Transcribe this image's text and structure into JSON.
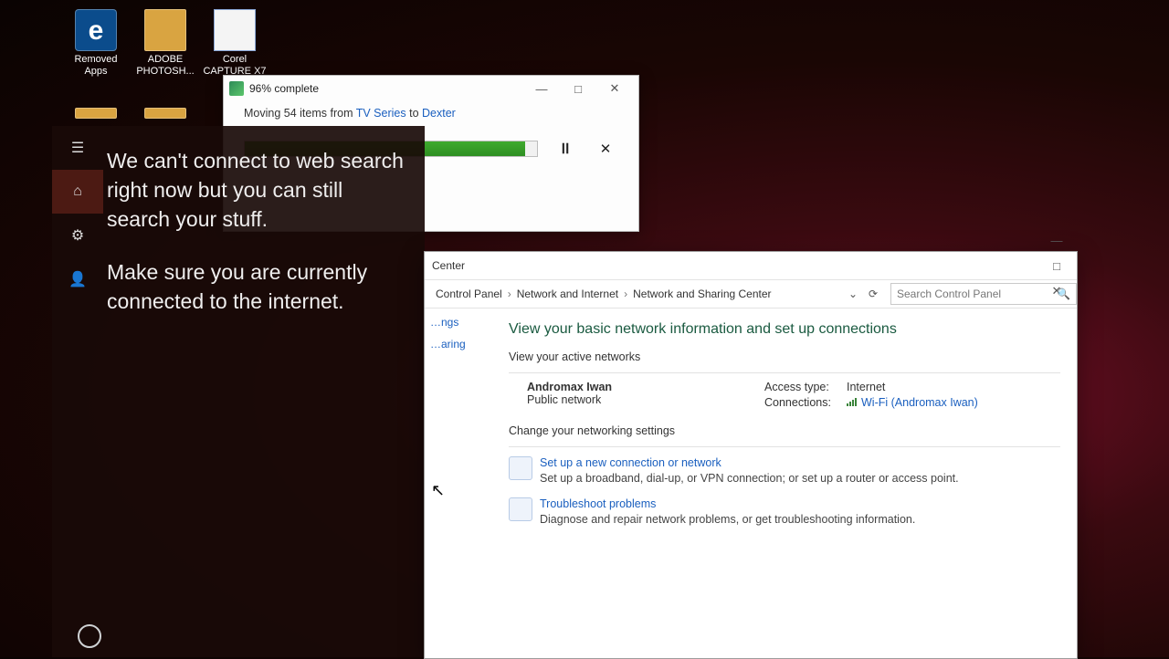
{
  "desktop_icons": [
    {
      "label": "Removed Apps",
      "kind": "edge"
    },
    {
      "label": "ADOBE PHOTOSH...",
      "kind": "folder"
    },
    {
      "label": "Corel CAPTURE X7",
      "kind": "doc"
    }
  ],
  "cortana": {
    "msg1": "We can't connect to web search right now but you can still search your stuff.",
    "msg2": "Make sure you are currently connected to the internet."
  },
  "copy_dialog": {
    "title": "96% complete",
    "action_prefix": "Moving 54 items from ",
    "source": "TV Series",
    "mid": " to ",
    "dest": "Dexter",
    "percent": 96
  },
  "control_panel": {
    "window_title": "Center",
    "breadcrumbs": [
      "Control Panel",
      "Network and Internet",
      "Network and Sharing Center"
    ],
    "search_placeholder": "Search Control Panel",
    "tasks": [
      "…ngs",
      "…aring"
    ],
    "heading": "View your basic network information and set up connections",
    "active_label": "View your active networks",
    "network": {
      "name": "Andromax Iwan",
      "profile": "Public network",
      "access_label": "Access type:",
      "access_value": "Internet",
      "conn_label": "Connections:",
      "conn_value": "Wi-Fi (Andromax Iwan)"
    },
    "change_label": "Change your networking settings",
    "options": [
      {
        "link": "Set up a new connection or network",
        "desc": "Set up a broadband, dial-up, or VPN connection; or set up a router or access point."
      },
      {
        "link": "Troubleshoot problems",
        "desc": "Diagnose and repair network problems, or get troubleshooting information."
      }
    ]
  }
}
